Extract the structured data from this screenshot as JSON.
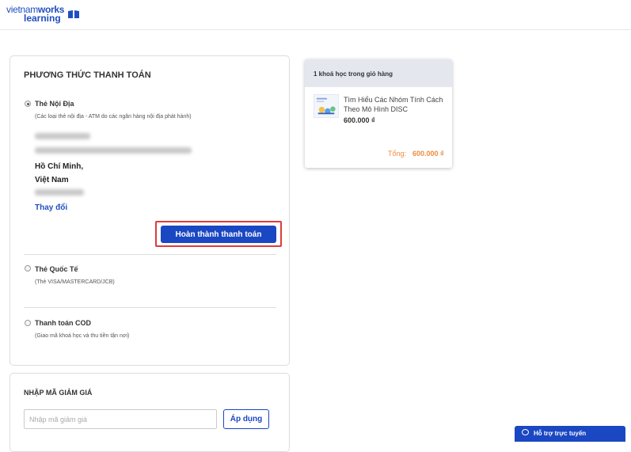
{
  "logo": {
    "line1_a": "vietnam",
    "line1_b": "works",
    "line2": "learning",
    "color": "#1f4fbf"
  },
  "payment": {
    "title": "PHƯƠNG THỨC THANH TOÁN",
    "options": [
      {
        "label": "Thẻ Nội Địa",
        "sub": "(Các loại thẻ nội địa - ATM do các ngân hàng nội địa phát hành)",
        "selected": true
      },
      {
        "label": "Thẻ Quốc Tế",
        "sub": "(Thẻ VISA/MASTERCARD/JCB)",
        "selected": false
      },
      {
        "label": "Thanh toán COD",
        "sub": "(Giao mã khoá học và thu tiền tận nơi)",
        "selected": false
      }
    ],
    "address": {
      "city": "Hồ Chí Minh,",
      "country": "Việt Nam"
    },
    "change_link": "Thay đổi",
    "complete_button": "Hoàn thành thanh toán"
  },
  "coupon": {
    "title": "NHẬP MÃ GIẢM GIÁ",
    "placeholder": "Nhập mã giảm giá",
    "apply_button": "Áp dụng"
  },
  "cart": {
    "header": "1 khoá học trong giỏ hàng",
    "items": [
      {
        "name": "Tìm Hiểu Các Nhóm Tính Cách Theo Mô Hình DISC",
        "price": "600.000 ₫"
      }
    ],
    "total_label": "Tổng:",
    "total_value": "600.000 ₫"
  },
  "support": {
    "label": "Hỗ trợ trực tuyến",
    "icon": "chat-bubble-icon"
  },
  "colors": {
    "primary": "#1a47c2",
    "highlight": "#e03a3a",
    "total": "#f08a3a"
  }
}
